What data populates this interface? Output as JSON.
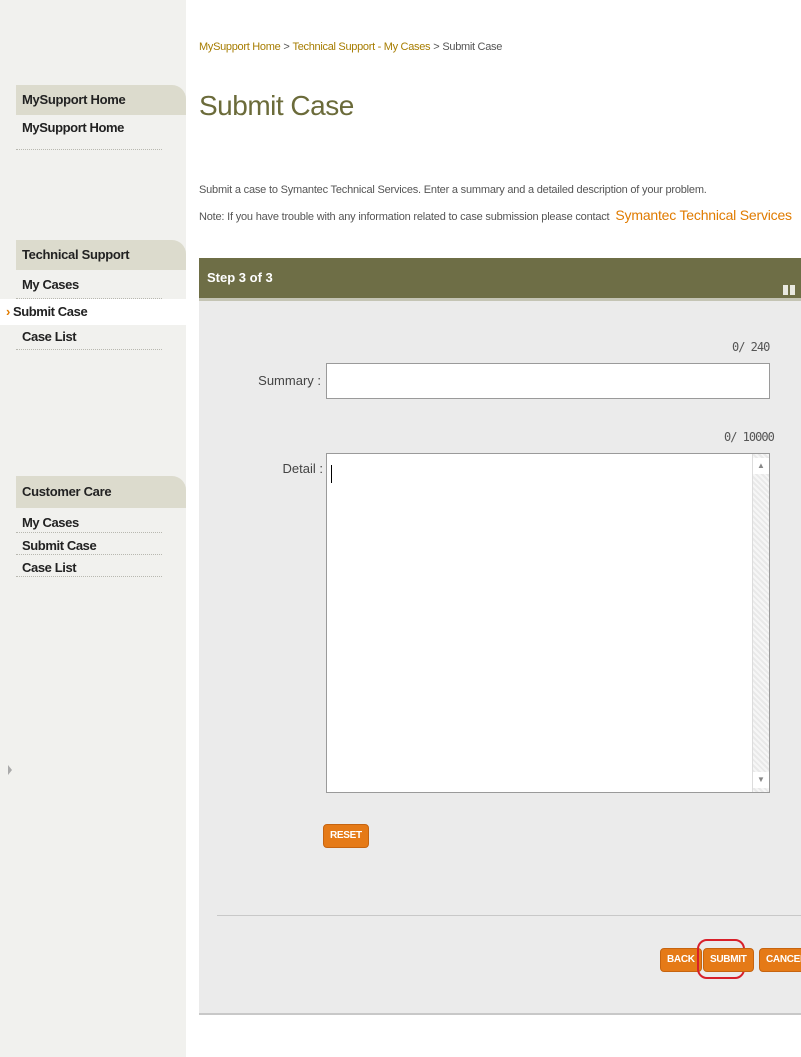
{
  "sidebar": {
    "sections": [
      {
        "header": "MySupport Home",
        "items": [
          {
            "label": "MySupport Home"
          }
        ]
      },
      {
        "header": "Technical Support",
        "items": [
          {
            "label": "My Cases"
          },
          {
            "label": "Submit Case",
            "active": true
          },
          {
            "label": "Case List"
          }
        ]
      },
      {
        "header": "Customer Care",
        "items": [
          {
            "label": "My Cases"
          },
          {
            "label": "Submit Case"
          },
          {
            "label": "Case List"
          }
        ]
      }
    ]
  },
  "breadcrumb": {
    "items": [
      "MySupport Home",
      "Technical Support - My Cases",
      "Submit Case"
    ],
    "separator": ">"
  },
  "page": {
    "title": "Submit Case",
    "intro_line1": "Submit a case to Symantec Technical Services. Enter a summary and a detailed description of your problem.",
    "intro_line2": "Note: If you have trouble with any information related to case submission please contact",
    "contact_link": "Symantec Technical Services"
  },
  "panel": {
    "step_label": "Step 3 of 3",
    "summary": {
      "label": "Summary :",
      "counter": "0/ 240",
      "value": ""
    },
    "detail": {
      "label": "Detail :",
      "counter": "0/ 10000",
      "value": ""
    },
    "reset_label": "RESET",
    "back_label": "BACK",
    "submit_label": "SUBMIT",
    "cancel_label": "CANCEL"
  },
  "colors": {
    "accent_orange": "#e57a17",
    "header_olive": "#6e6e46",
    "title_olive": "#6b6b3a",
    "highlight_red": "#d8202a"
  },
  "icons": {
    "active_item_marker": "chevron-right-icon",
    "panel_header_icon": "collapse-icon"
  }
}
